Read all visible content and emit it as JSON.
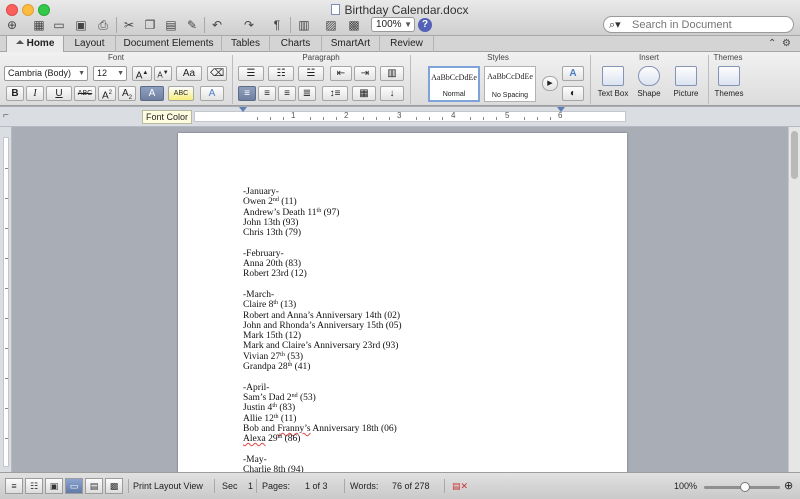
{
  "window": {
    "title": "Birthday Calendar.docx"
  },
  "toolbar": {
    "zoom": "100%",
    "help": "?",
    "search_placeholder": "Search in Document",
    "pilcrow": "¶"
  },
  "tabs": [
    {
      "label": "Home"
    },
    {
      "label": "Layout"
    },
    {
      "label": "Document Elements"
    },
    {
      "label": "Tables"
    },
    {
      "label": "Charts"
    },
    {
      "label": "SmartArt"
    },
    {
      "label": "Review"
    }
  ],
  "ribbon": {
    "groups": {
      "font": "Font",
      "paragraph": "Paragraph",
      "styles": "Styles",
      "insert": "Insert",
      "themes": "Themes"
    },
    "font_name": "Cambria (Body)",
    "font_size": "12",
    "buttons": {
      "grow": "A",
      "shrink": "A",
      "change_case": "Aa",
      "bold": "B",
      "italic": "I",
      "underline": "U",
      "strikethrough": "ABC",
      "superscript": "A",
      "subscript": "A",
      "highlight": "ABC"
    },
    "styles": [
      {
        "preview": "AaBbCcDdEe",
        "name": "Normal"
      },
      {
        "preview": "AaBbCcDdEe",
        "name": "No Spacing"
      }
    ],
    "insert": [
      {
        "label": "Text Box"
      },
      {
        "label": "Shape"
      },
      {
        "label": "Picture"
      }
    ],
    "themes_label": "Themes"
  },
  "tooltip": "Font Color",
  "ruler": {
    "numbers": [
      "1",
      "2",
      "3",
      "4",
      "5",
      "6"
    ]
  },
  "document": {
    "lines": [
      {
        "text": "-January-"
      },
      {
        "text": "Owen 2",
        "sup": "nd",
        "after": " (11)"
      },
      {
        "text": "Andrew’s Death 11",
        "sup": "th",
        "after": " (97)"
      },
      {
        "text": "John 13th (93)"
      },
      {
        "text": "Chris 13th (79)"
      },
      {
        "text": ""
      },
      {
        "text": "-February-"
      },
      {
        "text": "Anna 20th (83)"
      },
      {
        "text": "Robert 23rd (12)"
      },
      {
        "text": ""
      },
      {
        "text": "-March-"
      },
      {
        "text": "Claire 8",
        "sup": "th",
        "after": " (13)"
      },
      {
        "text": "Robert and Anna’s Anniversary 14th (02)"
      },
      {
        "text": "John and Rhonda’s Anniversary 15th (05)"
      },
      {
        "text": "Mark 15th (12)"
      },
      {
        "text": "Mark and Claire’s Anniversary 23rd (93)"
      },
      {
        "text": "Vivian 27",
        "sup": "th",
        "after": " (53)"
      },
      {
        "text": "Grandpa 28",
        "sup": "th",
        "after": " (41)"
      },
      {
        "text": ""
      },
      {
        "text": "-April-"
      },
      {
        "text": "Sam’s Dad 2",
        "sup": "nd",
        "after": " (53)"
      },
      {
        "text": "Justin 4",
        "sup": "th",
        "after": " (83)"
      },
      {
        "text": "Allie 12",
        "sup": "th",
        "after": " (11)"
      },
      {
        "text": "Bob and Franny’s Anniversary 18th (06)",
        "squiggle": "Franny’s"
      },
      {
        "text": "Alexa 29",
        "sup": "th",
        "after": " (86)",
        "squiggle": "Alexa"
      },
      {
        "text": ""
      },
      {
        "text": "-May-"
      },
      {
        "text": "Charlie 8th (94)"
      }
    ]
  },
  "status": {
    "view": "Print Layout View",
    "sec_label": "Sec",
    "sec_value": "1",
    "pages_label": "Pages:",
    "pages_value": "1 of 3",
    "words_label": "Words:",
    "words_value": "76 of 278",
    "zoom": "100%"
  },
  "colors": {
    "accent": "#5b7fb5",
    "spelling": "#e04545"
  }
}
